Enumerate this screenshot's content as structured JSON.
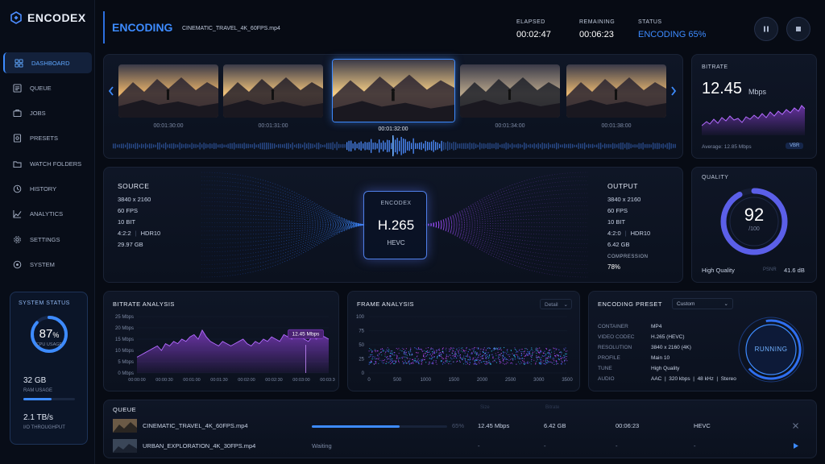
{
  "app": {
    "name": "ENCODEX"
  },
  "sidebar": {
    "items": [
      {
        "label": "DASHBOARD",
        "icon": "dashboard-icon",
        "active": true
      },
      {
        "label": "QUEUE",
        "icon": "queue-icon"
      },
      {
        "label": "JOBS",
        "icon": "jobs-icon"
      },
      {
        "label": "PRESETS",
        "icon": "presets-icon"
      },
      {
        "label": "WATCH FOLDERS",
        "icon": "folder-icon"
      },
      {
        "label": "HISTORY",
        "icon": "history-icon"
      },
      {
        "label": "ANALYTICS",
        "icon": "analytics-icon"
      },
      {
        "label": "SETTINGS",
        "icon": "gear-icon"
      },
      {
        "label": "SYSTEM",
        "icon": "system-icon"
      }
    ]
  },
  "system_status": {
    "title": "SYSTEM STATUS",
    "cpu_value": "87",
    "cpu_unit": "%",
    "cpu_label": "CPU USAGE",
    "cpu_fraction": 0.87,
    "ram_value": "32 GB",
    "ram_label": "RAM USAGE",
    "ram_fraction": 0.55,
    "io_value": "2.1 TB/s",
    "io_label": "I/O THROUGHPUT"
  },
  "header": {
    "title": "ENCODING",
    "filename": "CINEMATIC_TRAVEL_4K_60FPS.mp4",
    "elapsed_label": "ELAPSED",
    "elapsed_value": "00:02:47",
    "remaining_label": "REMAINING",
    "remaining_value": "00:06:23",
    "status_label": "STATUS",
    "status_value": "ENCODING 65%"
  },
  "timeline": {
    "timecodes": [
      "00:01:30:00",
      "00:01:31:00",
      "00:01:32:00",
      "00:01:34:00",
      "00:01:38:00"
    ],
    "selected_index": 2
  },
  "bitrate_panel": {
    "title": "BITRATE",
    "value": "12.45",
    "unit": "Mbps",
    "average": "Average: 12.85 Mbps",
    "mode": "VBR"
  },
  "source": {
    "title": "SOURCE",
    "resolution": "3840 x 2160",
    "fps": "60 FPS",
    "bitdepth": "10 BIT",
    "chroma": "4:2:2",
    "hdr": "HDR10",
    "size": "29.97 GB"
  },
  "codec": {
    "brand": "ENCODEX",
    "name": "H.265",
    "alias": "HEVC"
  },
  "output": {
    "title": "OUTPUT",
    "resolution": "3840 x 2160",
    "fps": "60 FPS",
    "bitdepth": "10 BIT",
    "chroma": "4:2:0",
    "hdr": "HDR10",
    "size": "6.42 GB",
    "compression_label": "COMPRESSION",
    "compression_value": "78%"
  },
  "quality": {
    "title": "QUALITY",
    "score": "92",
    "max": "/100",
    "score_fraction": 0.92,
    "label": "High Quality",
    "metric": "PSNR",
    "metric_value": "41.6 dB"
  },
  "bitrate_analysis": {
    "title": "BITRATE ANALYSIS",
    "marker_label": "12.45 Mbps"
  },
  "frame_analysis": {
    "title": "FRAME ANALYSIS",
    "dropdown": "Detail"
  },
  "preset": {
    "title": "ENCODING PRESET",
    "dropdown": "Custom",
    "rows": [
      {
        "label": "CONTAINER",
        "value": "MP4"
      },
      {
        "label": "VIDEO CODEC",
        "value": "H.265 (HEVC)"
      },
      {
        "label": "RESOLUTION",
        "value": "3840 x 2160 (4K)"
      },
      {
        "label": "PROFILE",
        "value": "Main 10"
      },
      {
        "label": "TUNE",
        "value": "High Quality"
      },
      {
        "label": "AUDIO",
        "value": "AAC  |  320 kbps  |  48 kHz  |  Stereo"
      }
    ],
    "state": "RUNNING"
  },
  "queue": {
    "title": "QUEUE",
    "headers": [
      "Size",
      "Bitrate"
    ],
    "rows": [
      {
        "name": "CINEMATIC_TRAVEL_4K_60FPS.mp4",
        "progress_fraction": 0.65,
        "percent": "65%",
        "bitrate": "12.45 Mbps",
        "size": "6.42 GB",
        "eta": "00:06:23",
        "codec": "HEVC",
        "action": "close-icon"
      },
      {
        "name": "URBAN_EXPLORATION_4K_30FPS.mp4",
        "status": "Waiting",
        "bitrate": "-",
        "size": "-",
        "eta": "-",
        "codec": "-",
        "action": "play-icon"
      }
    ]
  },
  "chart_data": [
    {
      "type": "area",
      "title": "BITRATE ANALYSIS",
      "x": [
        "00:00:00",
        "00:00:30",
        "00:01:00",
        "00:01:30",
        "00:02:00",
        "00:02:30",
        "00:03:00",
        "00:03:30"
      ],
      "y_ticks": [
        "0 Mbps",
        "5 Mbps",
        "10 Mbps",
        "15 Mbps",
        "20 Mbps",
        "25 Mbps"
      ],
      "ylim": [
        0,
        25
      ],
      "values": [
        7,
        8,
        9,
        10,
        11,
        12,
        10,
        13,
        12,
        14,
        13,
        15,
        14,
        16,
        17,
        15,
        19,
        16,
        14,
        13,
        12,
        14,
        13,
        12,
        13,
        14,
        15,
        13,
        12,
        14,
        13,
        15,
        14,
        16,
        15,
        14,
        17,
        16,
        15,
        18,
        16,
        15,
        14,
        16,
        15,
        17,
        16,
        15
      ],
      "marker_value": 12.45,
      "color": "#8a3fd1"
    },
    {
      "type": "scatter",
      "title": "FRAME ANALYSIS",
      "x_ticks": [
        "0",
        "500",
        "1000",
        "1500",
        "2000",
        "2500",
        "3000",
        "3500"
      ],
      "y_ticks": [
        "0",
        "25",
        "50",
        "75",
        "100"
      ],
      "xlim": [
        0,
        3500
      ],
      "ylim": [
        0,
        100
      ],
      "band": [
        15,
        45
      ],
      "colors": [
        "#3d6cff",
        "#9b4dff",
        "#d24cff",
        "#35c7ff"
      ]
    }
  ]
}
